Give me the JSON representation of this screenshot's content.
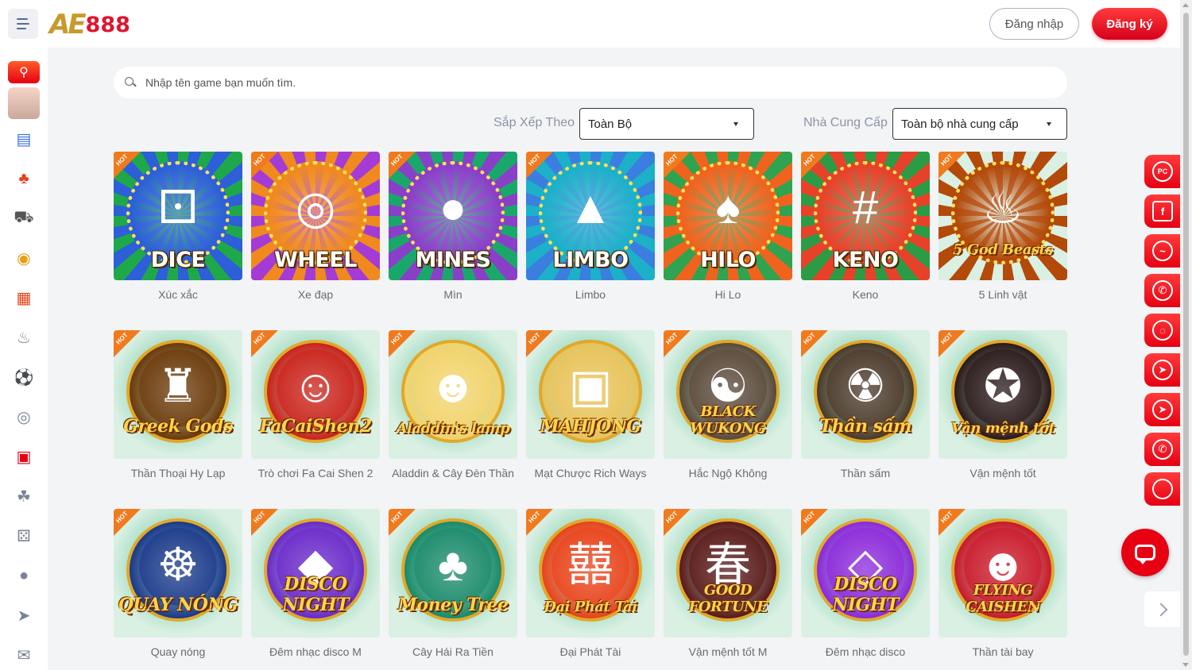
{
  "header": {
    "logo_ae": "AE",
    "logo_num": "888",
    "login_label": "Đăng nhập",
    "register_label": "Đăng ký"
  },
  "sidebar": {
    "items": [
      {
        "icon": "search-icon"
      },
      {
        "icon": "avatar"
      },
      {
        "icon": "lottery-icon"
      },
      {
        "icon": "live-casino-icon"
      },
      {
        "icon": "car-racing-icon"
      },
      {
        "icon": "coin-icon"
      },
      {
        "icon": "slots-icon"
      },
      {
        "icon": "fire-icon"
      },
      {
        "icon": "soccer-icon"
      },
      {
        "icon": "esports-icon"
      },
      {
        "icon": "slot-777-icon"
      },
      {
        "icon": "cockfight-icon"
      },
      {
        "icon": "dice-icon"
      },
      {
        "icon": "fishing-icon"
      },
      {
        "icon": "rocket-icon"
      },
      {
        "icon": "ticket-icon"
      }
    ]
  },
  "search": {
    "placeholder": "Nhập tên game bạn muốn tìm."
  },
  "filters": {
    "sort_label": "Sắp Xếp Theo",
    "sort_value": "Toàn Bộ",
    "provider_label": "Nhà Cung Cấp",
    "provider_value": "Toàn bộ nhà cung cấp"
  },
  "hot_label": "HOT",
  "games": [
    {
      "title_art": "DICE",
      "name": "Xúc xắc",
      "bg": "#1fa84a",
      "ring": "#2c5fd8"
    },
    {
      "title_art": "WHEEL",
      "name": "Xe đạp",
      "bg": "#a43bd6",
      "ring": "#f08a1e"
    },
    {
      "title_art": "MINES",
      "name": "Mìn",
      "bg": "#1aa86a",
      "ring": "#8a3fc9"
    },
    {
      "title_art": "LIMBO",
      "name": "Limbo",
      "bg": "#3a7fe0",
      "ring": "#1db0c9"
    },
    {
      "title_art": "HILO",
      "name": "Hi Lo",
      "bg": "#2fa34f",
      "ring": "#f0631e"
    },
    {
      "title_art": "KENO",
      "name": "Keno",
      "bg": "#2b9c45",
      "ring": "#e8412a"
    },
    {
      "title_art": "5 God Beasts",
      "name": "5 Linh vật",
      "bg": "#d9f0e3",
      "ring": "#b34a0a"
    },
    {
      "title_art": "Greek Gods",
      "name": "Thần Thoại Hy Lạp",
      "bg": "#d9f0e3",
      "ring": "#6b3a0a"
    },
    {
      "title_art": "FaCaiShen2",
      "name": "Trò chơi Fa Cai Shen 2",
      "bg": "#d9f0e3",
      "ring": "#c9231a"
    },
    {
      "title_art": "Aladdin's lamp",
      "name": "Aladdin & Cây Đèn Thần",
      "bg": "#d9f0e3",
      "ring": "#f2d36b"
    },
    {
      "title_art": "MAHJONG",
      "name": "Mạt Chược Rich Ways",
      "bg": "#d9f0e3",
      "ring": "#e8c35a"
    },
    {
      "title_art": "BLACK WUKONG",
      "name": "Hắc Ngộ Không",
      "bg": "#d9f0e3",
      "ring": "#5a4a3a"
    },
    {
      "title_art": "Thần sấm",
      "name": "Thần sấm",
      "bg": "#d9f0e3",
      "ring": "#4a3a2a"
    },
    {
      "title_art": "Vận mệnh tốt",
      "name": "Vận mệnh tốt",
      "bg": "#d9f0e3",
      "ring": "#2a1a1a"
    },
    {
      "title_art": "QUAY NÓNG",
      "name": "Quay nóng",
      "bg": "#d9f0e3",
      "ring": "#1a3a8a"
    },
    {
      "title_art": "DISCO NIGHT",
      "name": "Đêm nhạc disco M",
      "bg": "#d9f0e3",
      "ring": "#6a2ac9"
    },
    {
      "title_art": "Money Tree",
      "name": "Cây Hái Ra Tiền",
      "bg": "#d9f0e3",
      "ring": "#1a8a6a"
    },
    {
      "title_art": "Đại Phát Tài",
      "name": "Đại Phát Tài",
      "bg": "#d9f0e3",
      "ring": "#e8431a"
    },
    {
      "title_art": "GOOD FORTUNE",
      "name": "Vận mệnh tốt M",
      "bg": "#d9f0e3",
      "ring": "#5a1a1a"
    },
    {
      "title_art": "DISCO NIGHT",
      "name": "Đêm nhạc disco",
      "bg": "#d9f0e3",
      "ring": "#8a2ad9"
    },
    {
      "title_art": "FLYING CAISHEN",
      "name": "Thần tài bay",
      "bg": "#d9f0e3",
      "ring": "#c91a2a"
    }
  ],
  "float_buttons": [
    {
      "icon": "pc-icon"
    },
    {
      "icon": "facebook-icon"
    },
    {
      "icon": "messenger-icon"
    },
    {
      "icon": "whatsapp-icon"
    },
    {
      "icon": "wechat-icon"
    },
    {
      "icon": "telegram-icon"
    },
    {
      "icon": "telegram-icon"
    },
    {
      "icon": "phone-icon"
    },
    {
      "icon": "chat-icon"
    }
  ],
  "colors": {
    "brand_red": "#e60012",
    "logo_gold": "#c89a2e",
    "hot_orange": "#f07a1e"
  }
}
